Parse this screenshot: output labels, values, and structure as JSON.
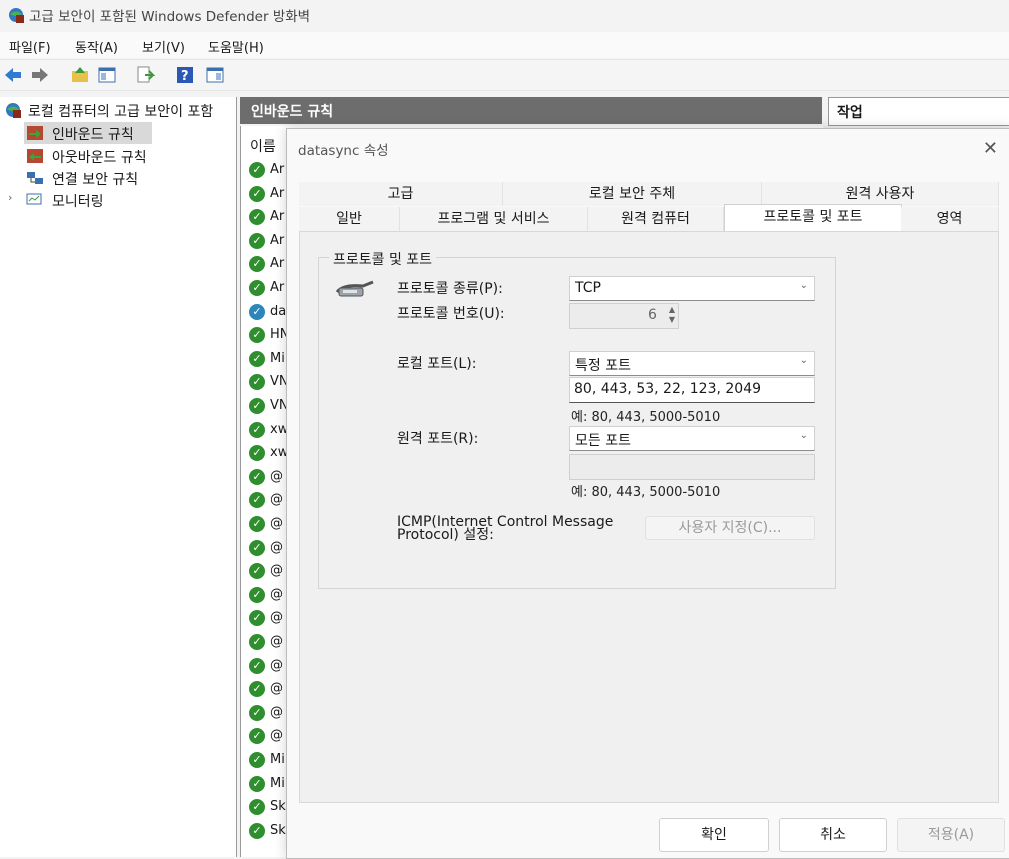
{
  "window": {
    "title": "고급 보안이 포함된 Windows Defender 방화벽"
  },
  "menu": [
    "파일(F)",
    "동작(A)",
    "보기(V)",
    "도움말(H)"
  ],
  "tree": {
    "root": "로컬 컴퓨터의 고급 보안이 포함",
    "items": [
      "인바운드 규칙",
      "아웃바운드 규칙",
      "연결 보안 규칙",
      "모니터링"
    ]
  },
  "middle": {
    "header": "인바운드 규칙",
    "column": "이름",
    "rows": [
      "Ar",
      "Ar",
      "Ar",
      "Ar",
      "Ar",
      "Ar",
      "da",
      "HN",
      "Mi",
      "VN",
      "VN",
      "xw",
      "xw",
      "@",
      "@",
      "@",
      "@",
      "@",
      "@",
      "@",
      "@",
      "@",
      "@",
      "@",
      "@",
      "Mi",
      "Mi",
      "Sk",
      "Sk"
    ]
  },
  "right": {
    "header": "작업"
  },
  "dialog": {
    "title": "datasync 속성",
    "close": "✕",
    "tabs_top": [
      "고급",
      "로컬 보안 주체",
      "원격 사용자"
    ],
    "tabs_bottom": [
      "일반",
      "프로그램 및 서비스",
      "원격 컴퓨터",
      "프로토콜 및 포트",
      "영역"
    ],
    "group_label": "프로토콜 및 포트",
    "protocol_type_label": "프로토콜 종류(P):",
    "protocol_type_value": "TCP",
    "protocol_number_label": "프로토콜 번호(U):",
    "protocol_number_value": "6",
    "local_port_label": "로컬 포트(L):",
    "local_port_value": "특정 포트",
    "local_port_list": "80, 443, 53, 22, 123, 2049",
    "local_port_hint": "예: 80, 443, 5000-5010",
    "remote_port_label": "원격 포트(R):",
    "remote_port_value": "모든 포트",
    "remote_port_list": "",
    "remote_port_hint": "예: 80, 443, 5000-5010",
    "icmp_label_1": "ICMP(Internet Control Message",
    "icmp_label_2": "Protocol) 설정:",
    "icmp_button": "사용자 지정(C)...",
    "ok": "확인",
    "cancel": "취소",
    "apply": "적용(A)"
  }
}
